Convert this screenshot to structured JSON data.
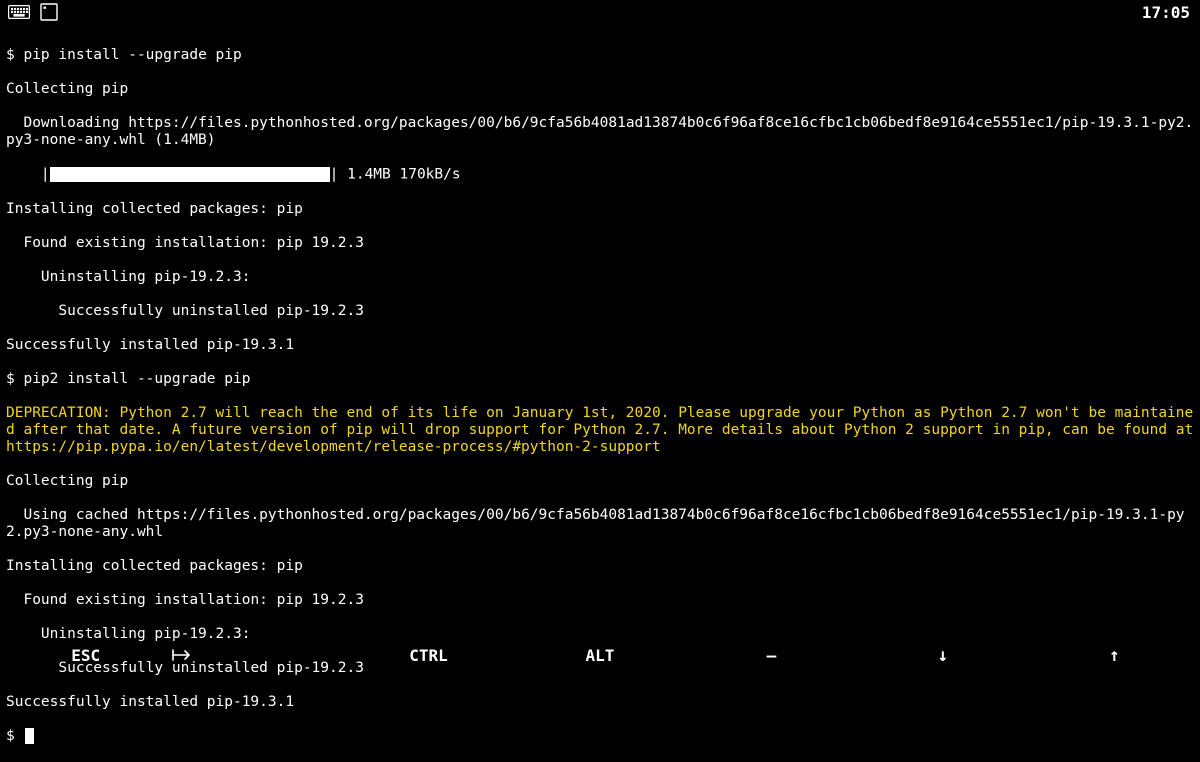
{
  "topbar": {
    "time": "17:05"
  },
  "terminal": {
    "l0_prompt": "$ ",
    "l0_cmd": "pip install --upgrade pip",
    "l1": "Collecting pip",
    "l2": "  Downloading https://files.pythonhosted.org/packages/00/b6/9cfa56b4081ad13874b0c6f96af8ce16cfbc1cb06bedf8e9164ce5551ec1/pip-19.3.1-py2.py3-none-any.whl (1.4MB)",
    "l3_left": "    |",
    "l3_right": "| 1.4MB 170kB/s",
    "l4": "Installing collected packages: pip",
    "l5": "  Found existing installation: pip 19.2.3",
    "l6": "    Uninstalling pip-19.2.3:",
    "l7": "      Successfully uninstalled pip-19.2.3",
    "l8": "Successfully installed pip-19.3.1",
    "l9_prompt": "$ ",
    "l9_cmd": "pip2 install --upgrade pip",
    "l10_dep": "DEPRECATION: Python 2.7 will reach the end of its life on January 1st, 2020. Please upgrade your Python as Python 2.7 won't be maintained after that date. A future version of pip will drop support for Python 2.7. More details about Python 2 support in pip, can be found at https://pip.pypa.io/en/latest/development/release-process/#python-2-support",
    "l11": "Collecting pip",
    "l12": "  Using cached https://files.pythonhosted.org/packages/00/b6/9cfa56b4081ad13874b0c6f96af8ce16cfbc1cb06bedf8e9164ce5551ec1/pip-19.3.1-py2.py3-none-any.whl",
    "l13": "Installing collected packages: pip",
    "l14": "  Found existing installation: pip 19.2.3",
    "l15": "    Uninstalling pip-19.2.3:",
    "l16": "      Successfully uninstalled pip-19.2.3",
    "l17": "Successfully installed pip-19.3.1",
    "l18_prompt": "$ "
  },
  "bottombar": {
    "esc": "ESC",
    "tab": "⇥",
    "ctrl": "CTRL",
    "alt": "ALT",
    "dash": "—",
    "down": "↓",
    "up": "↑"
  }
}
